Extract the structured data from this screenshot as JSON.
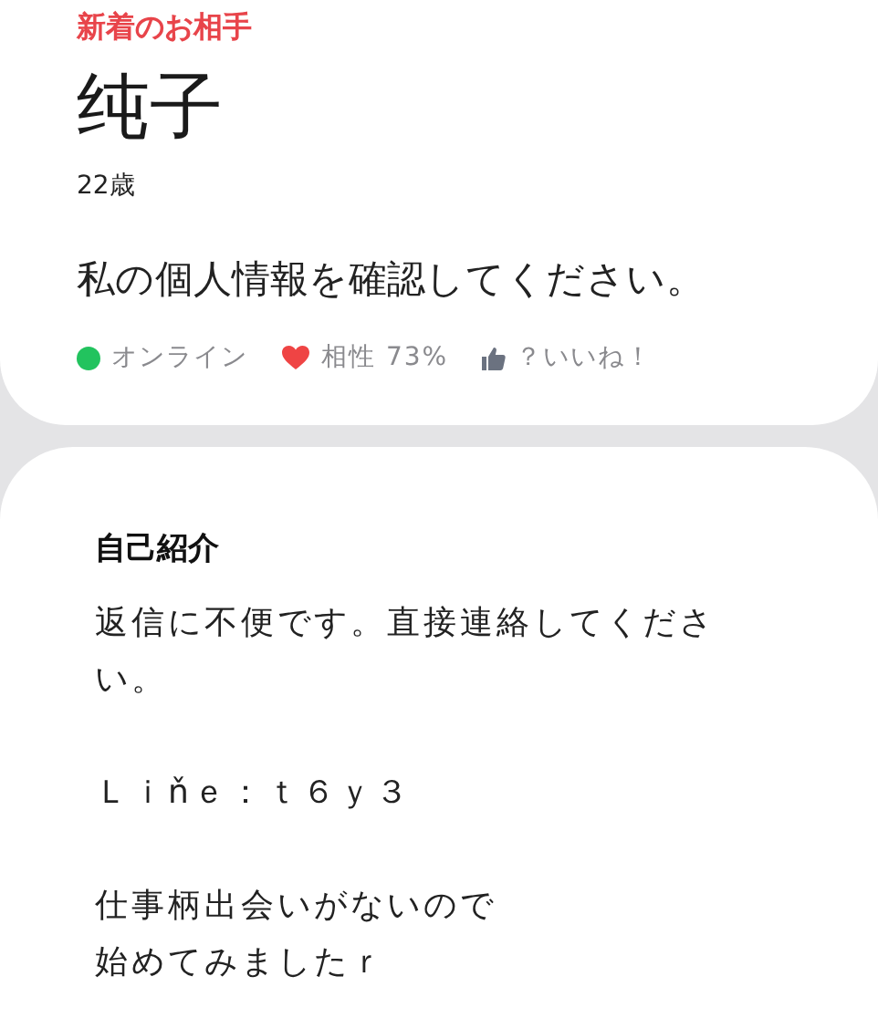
{
  "header": {
    "label": "新着のお相手",
    "name": "纯子",
    "age": "22歳",
    "message": "私の個人情報を確認してください。"
  },
  "stats": [
    {
      "kind": "status",
      "text": "オンライン",
      "color": "#22c35e"
    },
    {
      "kind": "heart",
      "text": "相性 73%"
    },
    {
      "kind": "thumb",
      "text": "？いいね！"
    }
  ],
  "intro": {
    "heading": "自己紹介",
    "paragraphs": [
      [
        "返信に不便です。直接連絡してください。"
      ],
      [
        "Ｌｉňｅ：ｔ６ｙ３"
      ],
      [
        "仕事柄出会いがないので",
        "始めてみましたｒ"
      ]
    ]
  }
}
